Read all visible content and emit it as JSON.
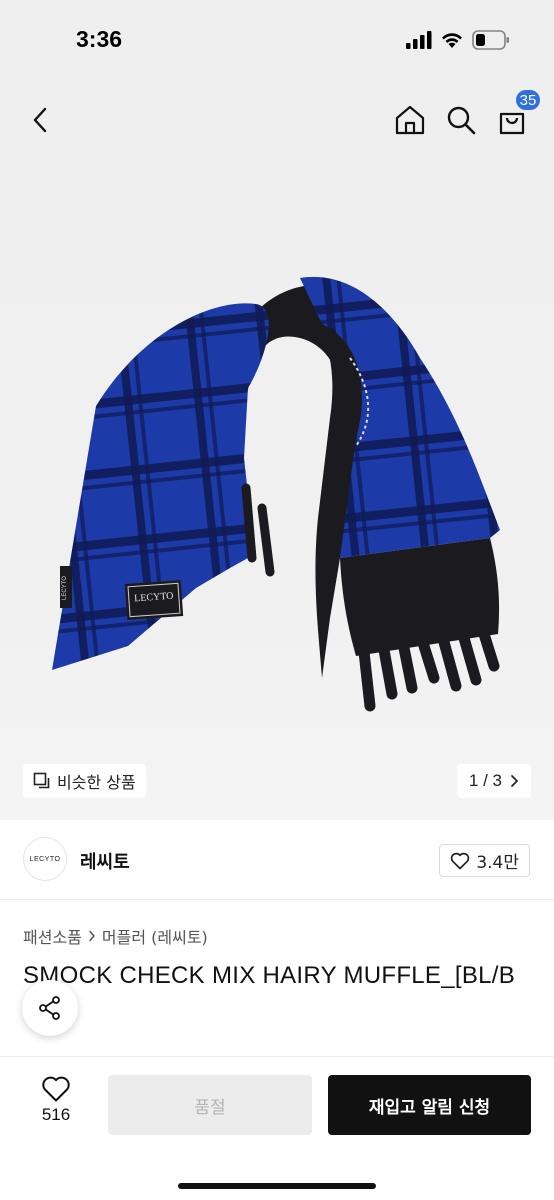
{
  "status_bar": {
    "time": "3:36"
  },
  "nav": {
    "cart_count": "35"
  },
  "gallery": {
    "similar_label": "비슷한 상품",
    "pager": "1 / 3",
    "patch_text": "LECYTO",
    "tag_text": "LECYTO",
    "colors": {
      "blue": "#1a3aa8",
      "black": "#1b1b1f"
    }
  },
  "brand": {
    "logo_text": "LECYTO",
    "name": "레씨토",
    "likes": "3.4만"
  },
  "breadcrumb": {
    "category": "패션소품",
    "subcategory": "머플러 (레씨토)"
  },
  "product": {
    "title": "SMOCK CHECK MIX HAIRY MUFFLE_[BL/B"
  },
  "bottom_bar": {
    "wish_count": "516",
    "soldout_label": "품절",
    "restock_label": "재입고 알림 신청"
  }
}
